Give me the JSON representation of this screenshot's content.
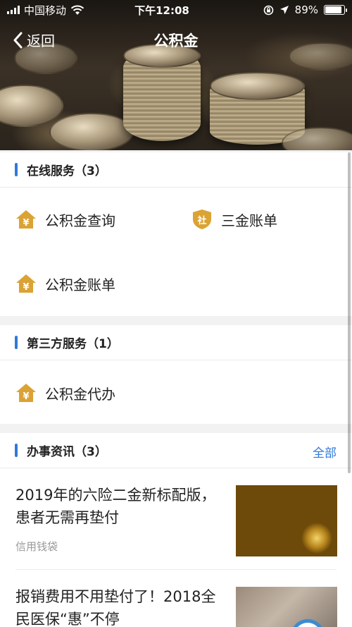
{
  "status_bar": {
    "carrier": "中国移动",
    "time": "下午12:08",
    "battery_percent": "89%",
    "battery_level": 0.89,
    "wifi_icon": "wifi-icon",
    "location_icon": "location-arrow-icon",
    "lock_icon": "rotation-lock-icon"
  },
  "nav": {
    "back_label": "返回",
    "title": "公积金"
  },
  "online_services": {
    "title": "在线服务（3）",
    "items": [
      {
        "label": "公积金查询",
        "icon": "housing-fund-icon"
      },
      {
        "label": "三金账单",
        "icon": "social-security-icon",
        "icon_text": "社"
      },
      {
        "label": "公积金账单",
        "icon": "housing-fund-icon"
      }
    ]
  },
  "third_party": {
    "title": "第三方服务（1）",
    "items": [
      {
        "label": "公积金代办",
        "icon": "housing-fund-icon"
      }
    ]
  },
  "news": {
    "title": "办事资讯（3）",
    "more_label": "全部",
    "items": [
      {
        "title": "2019年的六险二金新标配版，患者无需再垫付",
        "source": "信用钱袋"
      },
      {
        "title": "报销费用不用垫付了！2018全民医保“惠”不停",
        "source": ""
      }
    ]
  },
  "colors": {
    "accent": "#2f79d9",
    "icon_gold": "#dba234"
  }
}
